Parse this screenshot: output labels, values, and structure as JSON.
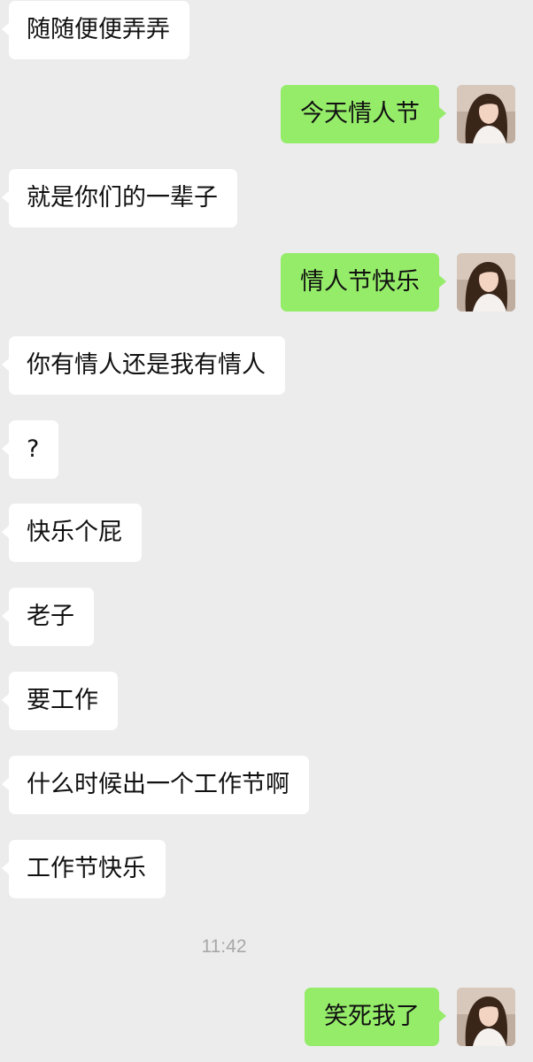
{
  "messages": [
    {
      "side": "left",
      "text": "随随便便弄弄"
    },
    {
      "side": "right",
      "text": "今天情人节"
    },
    {
      "side": "left",
      "text": "就是你们的一辈子"
    },
    {
      "side": "right",
      "text": "情人节快乐"
    },
    {
      "side": "left",
      "text": "你有情人还是我有情人"
    },
    {
      "side": "left",
      "text": "?"
    },
    {
      "side": "left",
      "text": "快乐个屁"
    },
    {
      "side": "left",
      "text": "老子"
    },
    {
      "side": "left",
      "text": "要工作"
    },
    {
      "side": "left",
      "text": "什么时候出一个工作节啊"
    },
    {
      "side": "left",
      "text": "工作节快乐"
    },
    {
      "side": "right",
      "text": "笑死我了"
    }
  ],
  "timestamp": "11:42",
  "colors": {
    "background": "#ececec",
    "incoming_bubble": "#ffffff",
    "outgoing_bubble": "#95ec69",
    "timestamp_text": "#a8a8a8"
  },
  "icons": {
    "avatar": "avatar-photo-icon"
  }
}
